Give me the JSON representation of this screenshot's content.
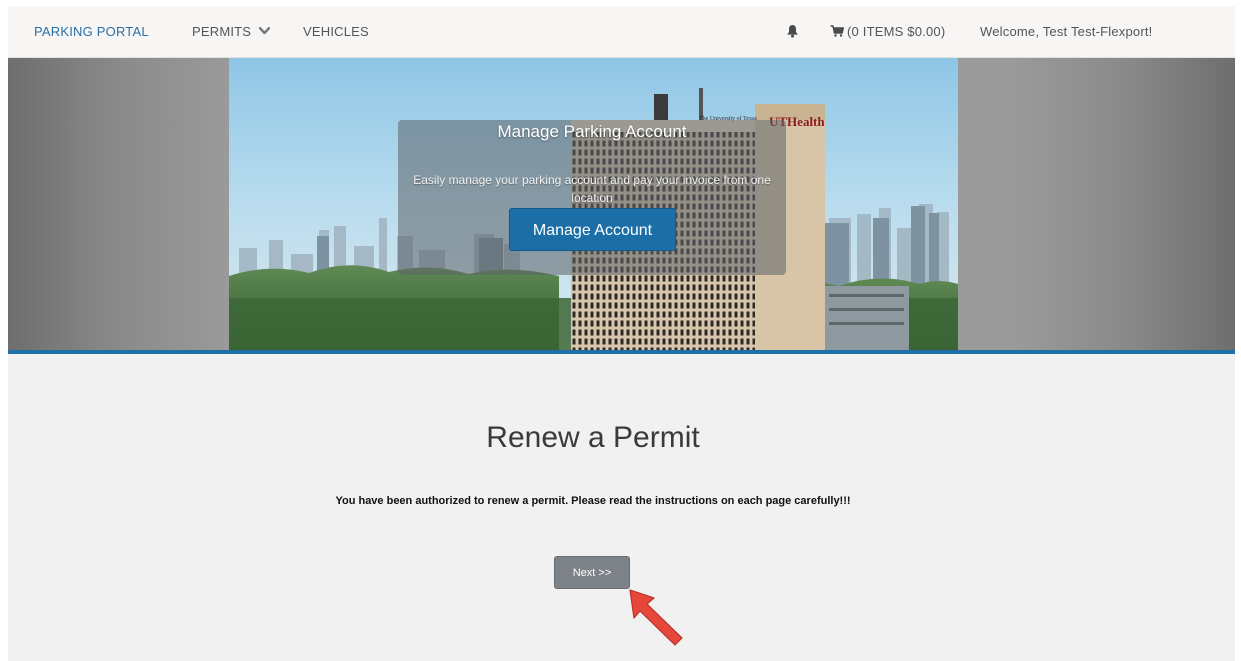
{
  "navbar": {
    "brand": "PARKING PORTAL",
    "permits": "PERMITS",
    "vehicles": "VEHICLES",
    "cart": "(0 ITEMS $0.00)",
    "welcome": "Welcome, Test Test-Flexport!"
  },
  "hero": {
    "title": "Manage Parking Account",
    "description": "Easily manage your parking account and pay your invoice from one location",
    "button": "Manage Account",
    "building_sign": "UTHealth",
    "building_sign_small": "The University of Texas"
  },
  "main": {
    "title": "Renew a Permit",
    "message": "You have been authorized to renew a permit. Please read the instructions on each page carefully!!!",
    "next_button": "Next >>"
  },
  "colors": {
    "accent": "#1b6ea6",
    "brand_link": "#2a6fa4",
    "band": "#1f6fa8",
    "next_button": "#7d8288",
    "annotation_arrow": "#e5483b"
  },
  "icons": {
    "permits_dropdown": "chevron-down-icon",
    "notifications": "bell-icon",
    "cart": "cart-icon",
    "annotation": "arrow-icon"
  }
}
